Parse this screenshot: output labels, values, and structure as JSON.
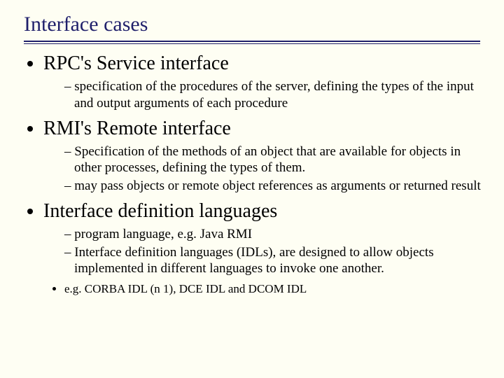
{
  "title": "Interface cases",
  "bullets": [
    {
      "text": "RPC's Service interface",
      "sub": [
        {
          "text": "specification of the procedures of the server, defining the types of the input and output arguments of each procedure"
        }
      ]
    },
    {
      "text": "RMI's Remote interface",
      "sub": [
        {
          "text": "Specification of the methods of an object that are available for objects in other processes, defining the types of them."
        },
        {
          "text": "may pass objects or remote object references as arguments or returned result"
        }
      ]
    },
    {
      "text": "Interface definition languages",
      "sub": [
        {
          "text": "program language, e.g. Java RMI"
        },
        {
          "text": "Interface definition languages (IDLs), are designed to allow objects implemented in different languages to invoke one another."
        }
      ],
      "subsub": [
        {
          "text": "e.g. CORBA IDL (n 1), DCE IDL and DCOM IDL"
        }
      ]
    }
  ]
}
